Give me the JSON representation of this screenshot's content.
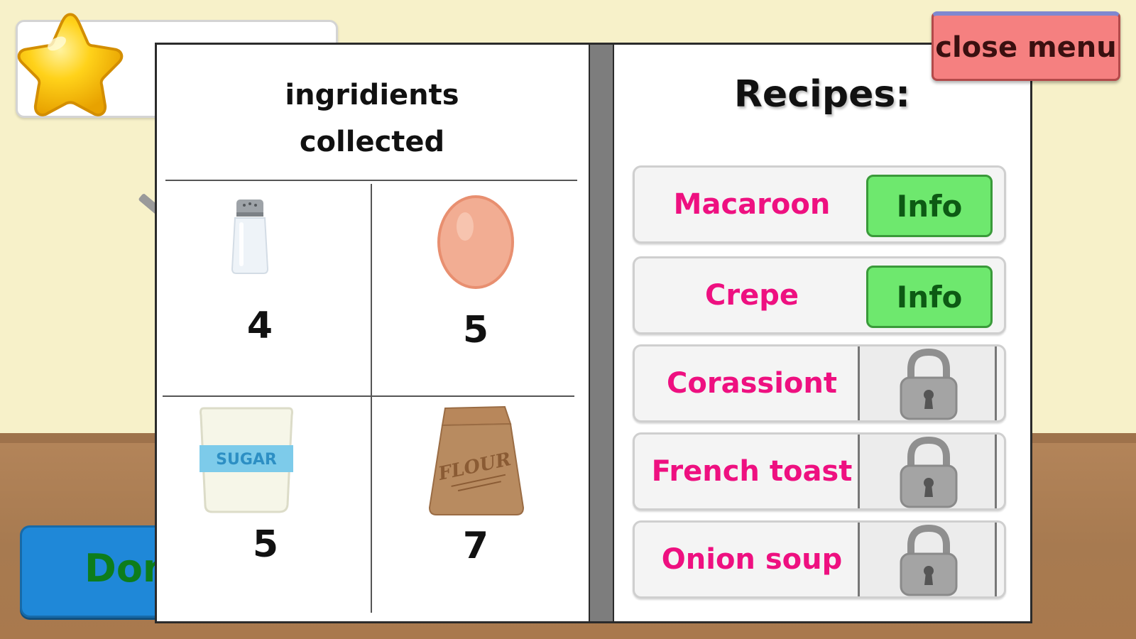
{
  "hud": {
    "star_icon": "star-icon",
    "done_label": "Don"
  },
  "book": {
    "left_page": {
      "title_line1": "ingridients",
      "title_line2": "collected",
      "ingredients": [
        {
          "icon": "salt-shaker-icon",
          "count": "4"
        },
        {
          "icon": "egg-icon",
          "count": "5"
        },
        {
          "icon": "sugar-bag-icon",
          "count": "5",
          "label": "SUGAR"
        },
        {
          "icon": "flour-bag-icon",
          "count": "7",
          "label": "FLOUR"
        }
      ]
    },
    "right_page": {
      "title": "Recipes:",
      "recipes": [
        {
          "name": "Macaroon",
          "state": "unlocked",
          "button_label": "Info"
        },
        {
          "name": "Crepe",
          "state": "unlocked",
          "button_label": "Info"
        },
        {
          "name": "Corassiont",
          "state": "locked",
          "icon": "padlock-icon"
        },
        {
          "name": "French toast",
          "state": "locked",
          "icon": "padlock-icon"
        },
        {
          "name": "Onion soup",
          "state": "locked",
          "icon": "padlock-icon"
        }
      ]
    }
  },
  "close_menu_label": "close menu",
  "colors": {
    "wall": "#f7f1c9",
    "floor": "#a77a50",
    "recipe_text": "#ee1080",
    "info_button": "#6ee86e",
    "close_button": "#f58080",
    "done_button": "#1f88d8"
  }
}
